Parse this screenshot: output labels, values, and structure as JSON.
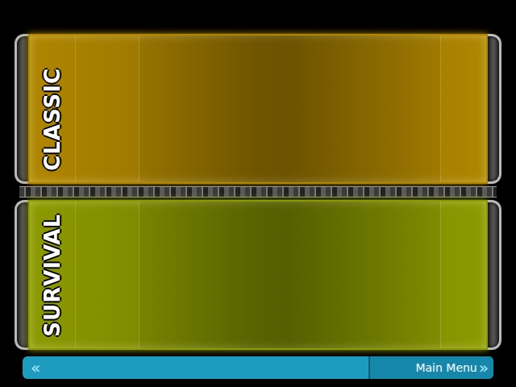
{
  "modes": [
    {
      "label": "CLASSIC",
      "color": "#b08600"
    },
    {
      "label": "SURVIVAL",
      "color": "#8c9a00"
    }
  ],
  "nav": {
    "back": "«",
    "button": "Main Menu",
    "arrow": "»"
  }
}
